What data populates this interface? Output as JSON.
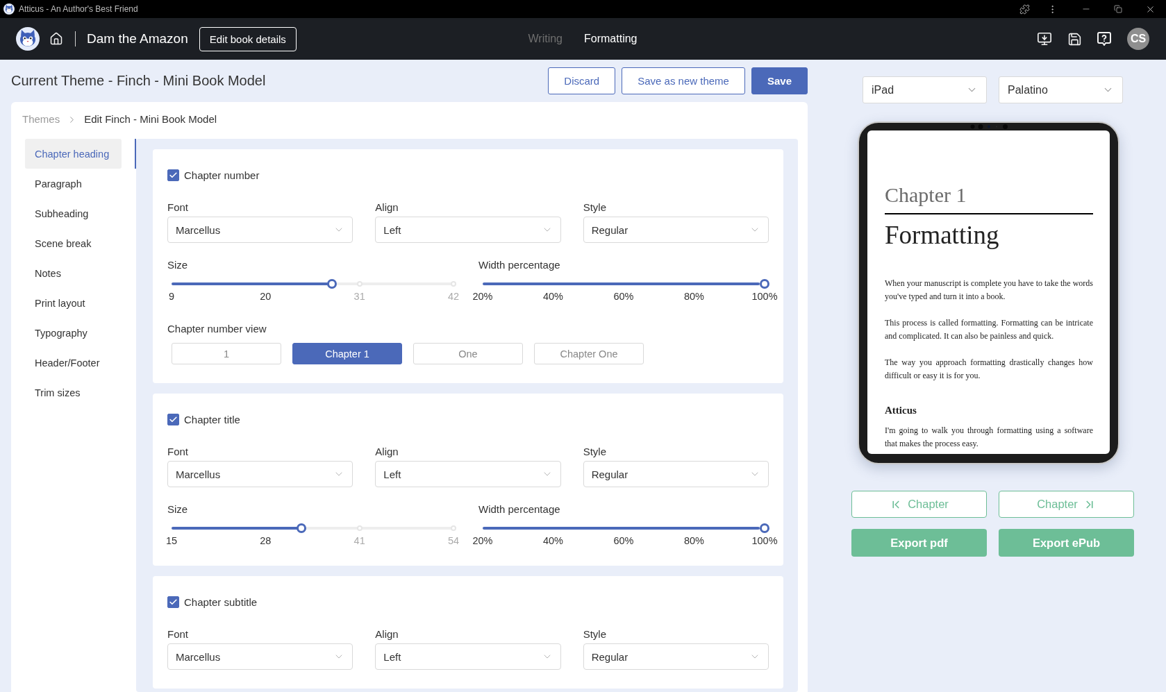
{
  "title_bar": {
    "title": "Atticus - An Author's Best Friend"
  },
  "header": {
    "book_title": "Dam the Amazon",
    "edit_button": "Edit book details",
    "tabs": [
      {
        "label": "Writing",
        "selected": false
      },
      {
        "label": "Formatting",
        "selected": true
      }
    ],
    "avatar": "CS"
  },
  "theme_bar": {
    "title": "Current Theme - Finch - Mini Book Model",
    "buttons": [
      {
        "label": "Discard",
        "kind": "outline"
      },
      {
        "label": "Save as new theme",
        "kind": "outline"
      },
      {
        "label": "Save",
        "kind": "primary"
      }
    ]
  },
  "breadcrumb": [
    {
      "label": "Themes",
      "kind": "link"
    },
    {
      "label": "Edit Finch - Mini Book Model",
      "kind": "current"
    }
  ],
  "sidebar": {
    "items": [
      {
        "label": "Chapter heading",
        "selected": true
      },
      {
        "label": "Paragraph",
        "selected": false
      },
      {
        "label": "Subheading",
        "selected": false
      },
      {
        "label": "Scene break",
        "selected": false
      },
      {
        "label": "Notes",
        "selected": false
      },
      {
        "label": "Print layout",
        "selected": false
      },
      {
        "label": "Typography",
        "selected": false
      },
      {
        "label": "Header/Footer",
        "selected": false
      },
      {
        "label": "Trim sizes",
        "selected": false
      }
    ]
  },
  "sections": [
    {
      "label": "Chapter number",
      "checked": true,
      "selects": [
        {
          "label": "Font",
          "value": "Marcellus"
        },
        {
          "label": "Align",
          "value": "Left"
        },
        {
          "label": "Style",
          "value": "Regular"
        }
      ],
      "sliders": [
        {
          "label": "Size",
          "level": 0.57,
          "ticks": [
            "9",
            "20",
            "31",
            "42"
          ]
        },
        {
          "label": "Width percentage",
          "level": 1,
          "ticks": [
            "20%",
            "40%",
            "60%",
            "80%",
            "100%"
          ]
        }
      ],
      "view": {
        "label": "Chapter number view",
        "options": [
          {
            "label": "1",
            "selected": false
          },
          {
            "label": "Chapter 1",
            "selected": true
          },
          {
            "label": "One",
            "selected": false
          },
          {
            "label": "Chapter One",
            "selected": false
          }
        ]
      }
    },
    {
      "label": "Chapter title",
      "checked": true,
      "selects": [
        {
          "label": "Font",
          "value": "Marcellus"
        },
        {
          "label": "Align",
          "value": "Left"
        },
        {
          "label": "Style",
          "value": "Regular"
        }
      ],
      "sliders": [
        {
          "label": "Size",
          "level": 0.46,
          "ticks": [
            "15",
            "28",
            "41",
            "54"
          ]
        },
        {
          "label": "Width percentage",
          "level": 1,
          "ticks": [
            "20%",
            "40%",
            "60%",
            "80%",
            "100%"
          ]
        }
      ]
    },
    {
      "label": "Chapter subtitle",
      "checked": true,
      "selects": [
        {
          "label": "Font",
          "value": "Marcellus"
        },
        {
          "label": "Align",
          "value": "Left"
        },
        {
          "label": "Style",
          "value": "Regular"
        }
      ]
    }
  ],
  "preview": {
    "device": "iPad",
    "font": "Palatino",
    "chapter_number": "Chapter 1",
    "chapter_title": "Formatting",
    "blocks": [
      {
        "kind": "paragraph",
        "text": "When your manuscript is complete you have to take the words you've typed and turn it into a book."
      },
      {
        "kind": "paragraph",
        "text": "This process is called formatting. Formatting can be intricate and complicated. It can also be painless and quick."
      },
      {
        "kind": "paragraph",
        "text": "The way you approach formatting drastically changes how difficult or easy it is for you."
      },
      {
        "kind": "subheading",
        "text": "Atticus"
      },
      {
        "kind": "paragraph",
        "text": "I'm going to walk you through formatting using a software that makes the process easy."
      }
    ],
    "nav_buttons": [
      {
        "label": "Chapter",
        "kind": "previous"
      },
      {
        "label": "Chapter",
        "kind": "next"
      }
    ],
    "export_buttons": [
      "Export pdf",
      "Export ePub"
    ]
  }
}
